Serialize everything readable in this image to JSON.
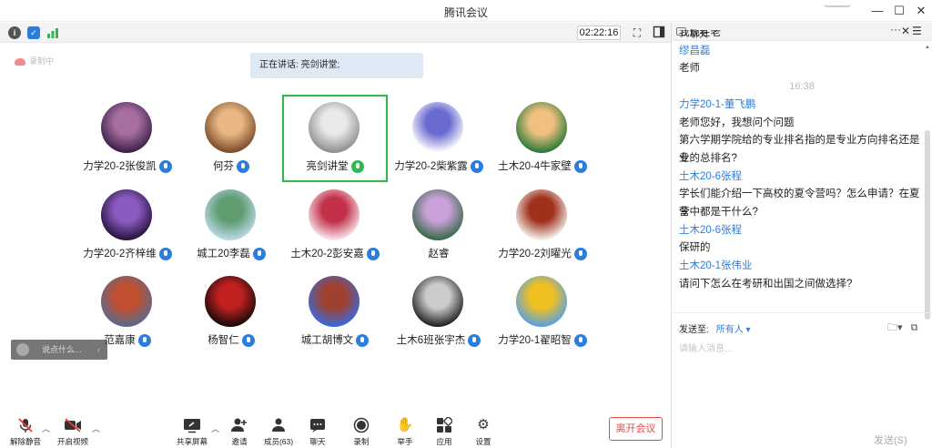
{
  "window": {
    "title": "腾讯会议",
    "min": "—",
    "max": "☐",
    "close": "✕"
  },
  "infobar": {
    "timer": "02:22:16",
    "info_icon": "info-icon",
    "shield_icon": "shield-icon",
    "signal_icon": "signal-icon"
  },
  "recording": {
    "label": "录制中"
  },
  "speaker": {
    "text": "正在讲话: 亮剑讲堂;"
  },
  "participants": [
    {
      "name": "力学20-2张俊凯",
      "mic": "blue",
      "avatar": "anime-girl",
      "colors": [
        "#3c1f4a",
        "#a66fa0"
      ]
    },
    {
      "name": "何芬",
      "mic": "blue",
      "avatar": "teddy-bear",
      "colors": [
        "#7c4b2a",
        "#e9b783"
      ]
    },
    {
      "name": "亮剑讲堂",
      "mic": "green",
      "avatar": "white-cat",
      "colors": [
        "#8f8f8f",
        "#e9e9e9"
      ]
    },
    {
      "name": "力学20-2柴紫露",
      "mic": "blue",
      "avatar": "flower-cartoon",
      "colors": [
        "#ffffff",
        "#6a6ad0"
      ]
    },
    {
      "name": "土木20-4牛家壁",
      "mic": "blue",
      "avatar": "cartoon-boy",
      "colors": [
        "#2a7a3a",
        "#f0c080"
      ]
    },
    {
      "name": "力学20-2齐梓维",
      "mic": "blue",
      "avatar": "purple-lion",
      "colors": [
        "#2a1240",
        "#8a5cc0"
      ]
    },
    {
      "name": "城工20李磊",
      "mic": "blue",
      "avatar": "lake-scene",
      "colors": [
        "#b9d8e6",
        "#5f9c6f"
      ]
    },
    {
      "name": "土木20-2彭安嘉",
      "mic": "blue",
      "avatar": "girl-red",
      "colors": [
        "#f7e4ea",
        "#c2304a"
      ]
    },
    {
      "name": "赵睿",
      "mic": "none",
      "avatar": "cartoon-dog",
      "colors": [
        "#3a6a4a",
        "#c9a0d8"
      ]
    },
    {
      "name": "力学20-2刘曜光",
      "mic": "blue",
      "avatar": "girl-portrait",
      "colors": [
        "#f2efe9",
        "#a0301c"
      ]
    },
    {
      "name": "范嘉康",
      "mic": "blue",
      "avatar": "soldiers",
      "colors": [
        "#5a6a8a",
        "#c05030"
      ]
    },
    {
      "name": "杨智仁",
      "mic": "blue",
      "avatar": "red-stage",
      "colors": [
        "#1a0a0a",
        "#c02020"
      ]
    },
    {
      "name": "城工胡博文",
      "mic": "blue",
      "avatar": "teddy-flag",
      "colors": [
        "#3a6ad8",
        "#a04030"
      ]
    },
    {
      "name": "土木6班张宇杰",
      "mic": "blue",
      "avatar": "bw-portrait",
      "colors": [
        "#222222",
        "#cccccc"
      ]
    },
    {
      "name": "力学20-1翟昭智",
      "mic": "blue",
      "avatar": "sunflower",
      "colors": [
        "#5aa0e0",
        "#f0c020"
      ]
    }
  ],
  "chat_input_overlay": {
    "placeholder": "说点什么...",
    "chevron": "‹"
  },
  "toolbar": {
    "unmute": "解除静音",
    "start_video": "开启视频",
    "share": "共享屏幕",
    "invite": "邀请",
    "members": "成员(63)",
    "chat": "聊天",
    "record": "录制",
    "raise_hand": "举手",
    "apps": "应用",
    "settings": "设置",
    "leave": "离开会议"
  },
  "chat": {
    "title": "聊天",
    "messages": [
      {
        "kind": "text",
        "text": "我现在老"
      },
      {
        "kind": "sender",
        "text": "缪昌磊"
      },
      {
        "kind": "text",
        "text": "老师"
      },
      {
        "kind": "time",
        "text": "16:38"
      },
      {
        "kind": "sender",
        "text": "力学20-1-董飞鹏"
      },
      {
        "kind": "text",
        "text": "老师您好，我想问个问题"
      },
      {
        "kind": "text",
        "text": "第六学期学院给的专业排名指的是专业方向排名还是专"
      },
      {
        "kind": "text",
        "text": "业的总排名?"
      },
      {
        "kind": "sender",
        "text": "土木20-6张程"
      },
      {
        "kind": "text",
        "text": "学长们能介绍一下高校的夏令营吗？怎么申请？在夏令"
      },
      {
        "kind": "text",
        "text": "营中都是干什么?"
      },
      {
        "kind": "sender",
        "text": "土木20-6张程"
      },
      {
        "kind": "text",
        "text": "保研的"
      },
      {
        "kind": "sender",
        "text": "土木20-1张伟业"
      },
      {
        "kind": "text",
        "text": "请问下怎么在考研和出国之间做选择?"
      }
    ],
    "send_to_label": "发送至:",
    "send_to_value": "所有人",
    "input_placeholder": "请输入消息...",
    "send_button": "发送(S)"
  }
}
